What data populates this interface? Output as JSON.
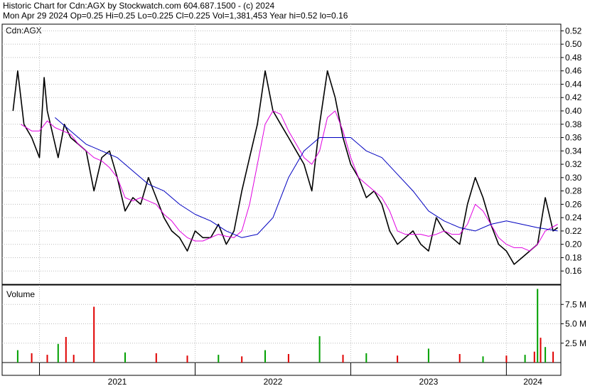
{
  "header": {
    "line1": "Historic Chart for Cdn:AGX by Stockwatch.com 604.687.1500 - (c) 2024",
    "line2": "Mon Apr 29 2024  Op=0.25  Hi=0.25  Lo=0.225  Cl=0.225  Vol=1,381,453  Year hi=0.52  lo=0.16"
  },
  "chart_data": [
    {
      "type": "line",
      "panel": "price",
      "title": "Cdn:AGX",
      "ylim": [
        0.14,
        0.53
      ],
      "y_ticks": [
        "0.52",
        "0.50",
        "0.48",
        "0.46",
        "0.44",
        "0.42",
        "0.40",
        "0.38",
        "0.36",
        "0.34",
        "0.32",
        "0.30",
        "0.28",
        "0.26",
        "0.24",
        "0.22",
        "0.20",
        "0.18",
        "0.16"
      ],
      "x_ticks": [
        "2021",
        "2022",
        "2023",
        "2024"
      ],
      "colors": {
        "price": "#000000",
        "ma_short": "#e000e0",
        "ma_long": "#0000c0"
      },
      "series": [
        {
          "role": "price",
          "x": [
            2020.83,
            2020.86,
            2020.9,
            2020.95,
            2021.0,
            2021.03,
            2021.05,
            2021.08,
            2021.12,
            2021.16,
            2021.2,
            2021.25,
            2021.3,
            2021.35,
            2021.4,
            2021.45,
            2021.5,
            2021.55,
            2021.6,
            2021.65,
            2021.7,
            2021.75,
            2021.8,
            2021.85,
            2021.9,
            2021.95,
            2022.0,
            2022.05,
            2022.1,
            2022.15,
            2022.2,
            2022.25,
            2022.3,
            2022.35,
            2022.4,
            2022.45,
            2022.5,
            2022.55,
            2022.6,
            2022.65,
            2022.7,
            2022.75,
            2022.8,
            2022.85,
            2022.9,
            2022.95,
            2023.0,
            2023.05,
            2023.1,
            2023.15,
            2023.2,
            2023.25,
            2023.3,
            2023.35,
            2023.4,
            2023.45,
            2023.5,
            2023.55,
            2023.6,
            2023.65,
            2023.7,
            2023.75,
            2023.8,
            2023.85,
            2023.9,
            2023.95,
            2024.0,
            2024.05,
            2024.1,
            2024.15,
            2024.2,
            2024.25,
            2024.3,
            2024.33
          ],
          "y": [
            0.4,
            0.46,
            0.38,
            0.36,
            0.33,
            0.45,
            0.4,
            0.37,
            0.33,
            0.38,
            0.36,
            0.35,
            0.34,
            0.28,
            0.33,
            0.34,
            0.3,
            0.25,
            0.27,
            0.26,
            0.3,
            0.27,
            0.24,
            0.22,
            0.21,
            0.19,
            0.22,
            0.21,
            0.21,
            0.23,
            0.2,
            0.22,
            0.28,
            0.33,
            0.38,
            0.46,
            0.4,
            0.38,
            0.36,
            0.34,
            0.32,
            0.28,
            0.38,
            0.46,
            0.42,
            0.36,
            0.32,
            0.3,
            0.27,
            0.28,
            0.26,
            0.22,
            0.2,
            0.21,
            0.22,
            0.2,
            0.19,
            0.24,
            0.22,
            0.21,
            0.2,
            0.26,
            0.3,
            0.27,
            0.23,
            0.2,
            0.19,
            0.17,
            0.18,
            0.19,
            0.2,
            0.27,
            0.22,
            0.225
          ]
        },
        {
          "role": "ma_short",
          "x": [
            2020.88,
            2020.95,
            2021.0,
            2021.05,
            2021.1,
            2021.15,
            2021.2,
            2021.25,
            2021.3,
            2021.35,
            2021.4,
            2021.45,
            2021.5,
            2021.55,
            2021.6,
            2021.65,
            2021.7,
            2021.75,
            2021.8,
            2021.85,
            2021.9,
            2021.95,
            2022.0,
            2022.05,
            2022.1,
            2022.15,
            2022.2,
            2022.25,
            2022.3,
            2022.35,
            2022.4,
            2022.45,
            2022.5,
            2022.55,
            2022.6,
            2022.65,
            2022.7,
            2022.75,
            2022.8,
            2022.85,
            2022.9,
            2022.95,
            2023.0,
            2023.05,
            2023.1,
            2023.15,
            2023.2,
            2023.25,
            2023.3,
            2023.35,
            2023.4,
            2023.45,
            2023.5,
            2023.55,
            2023.6,
            2023.65,
            2023.7,
            2023.75,
            2023.8,
            2023.85,
            2023.9,
            2023.95,
            2024.0,
            2024.05,
            2024.1,
            2024.15,
            2024.2,
            2024.25,
            2024.33
          ],
          "y": [
            0.38,
            0.37,
            0.37,
            0.385,
            0.375,
            0.37,
            0.365,
            0.35,
            0.34,
            0.33,
            0.325,
            0.315,
            0.3,
            0.27,
            0.265,
            0.27,
            0.265,
            0.26,
            0.245,
            0.235,
            0.22,
            0.21,
            0.205,
            0.205,
            0.21,
            0.215,
            0.212,
            0.21,
            0.22,
            0.26,
            0.32,
            0.38,
            0.4,
            0.395,
            0.37,
            0.35,
            0.33,
            0.32,
            0.34,
            0.39,
            0.4,
            0.37,
            0.33,
            0.3,
            0.29,
            0.28,
            0.27,
            0.25,
            0.22,
            0.215,
            0.215,
            0.215,
            0.212,
            0.215,
            0.22,
            0.215,
            0.215,
            0.23,
            0.26,
            0.25,
            0.23,
            0.21,
            0.2,
            0.195,
            0.195,
            0.19,
            0.2,
            0.22,
            0.23
          ]
        },
        {
          "role": "ma_long",
          "x": [
            2021.1,
            2021.2,
            2021.3,
            2021.4,
            2021.5,
            2021.6,
            2021.7,
            2021.8,
            2021.9,
            2022.0,
            2022.1,
            2022.2,
            2022.3,
            2022.4,
            2022.5,
            2022.6,
            2022.7,
            2022.8,
            2022.9,
            2023.0,
            2023.1,
            2023.2,
            2023.3,
            2023.4,
            2023.5,
            2023.6,
            2023.7,
            2023.8,
            2023.9,
            2024.0,
            2024.1,
            2024.2,
            2024.33
          ],
          "y": [
            0.39,
            0.37,
            0.35,
            0.34,
            0.33,
            0.31,
            0.29,
            0.28,
            0.26,
            0.245,
            0.235,
            0.22,
            0.21,
            0.215,
            0.24,
            0.3,
            0.34,
            0.36,
            0.36,
            0.36,
            0.34,
            0.33,
            0.305,
            0.28,
            0.25,
            0.235,
            0.225,
            0.22,
            0.23,
            0.235,
            0.23,
            0.225,
            0.22
          ]
        }
      ]
    },
    {
      "type": "bar",
      "panel": "volume",
      "title": "Volume",
      "ylim": [
        0,
        10
      ],
      "y_ticks": [
        "7.5 M",
        "5.0 M",
        "2.5 M"
      ],
      "colors": {
        "up": "#00a000",
        "down": "#e00000"
      },
      "x": [
        2020.86,
        2020.95,
        2021.05,
        2021.12,
        2021.17,
        2021.22,
        2021.35,
        2021.55,
        2021.75,
        2021.95,
        2022.15,
        2022.3,
        2022.45,
        2022.6,
        2022.8,
        2022.95,
        2023.1,
        2023.3,
        2023.5,
        2023.7,
        2023.85,
        2024.0,
        2024.12,
        2024.18,
        2024.2,
        2024.22,
        2024.25,
        2024.3
      ],
      "values": [
        1.6,
        1.2,
        1.0,
        2.4,
        3.3,
        1.0,
        7.2,
        1.3,
        1.2,
        0.9,
        1.0,
        0.8,
        1.6,
        1.1,
        3.4,
        1.0,
        1.2,
        0.9,
        1.8,
        1.1,
        0.8,
        0.9,
        1.0,
        1.4,
        9.5,
        3.2,
        2.0,
        1.4
      ],
      "up": [
        true,
        false,
        false,
        true,
        false,
        false,
        false,
        true,
        false,
        false,
        true,
        false,
        true,
        false,
        true,
        false,
        true,
        false,
        true,
        false,
        true,
        false,
        true,
        false,
        true,
        false,
        true,
        false
      ]
    }
  ]
}
